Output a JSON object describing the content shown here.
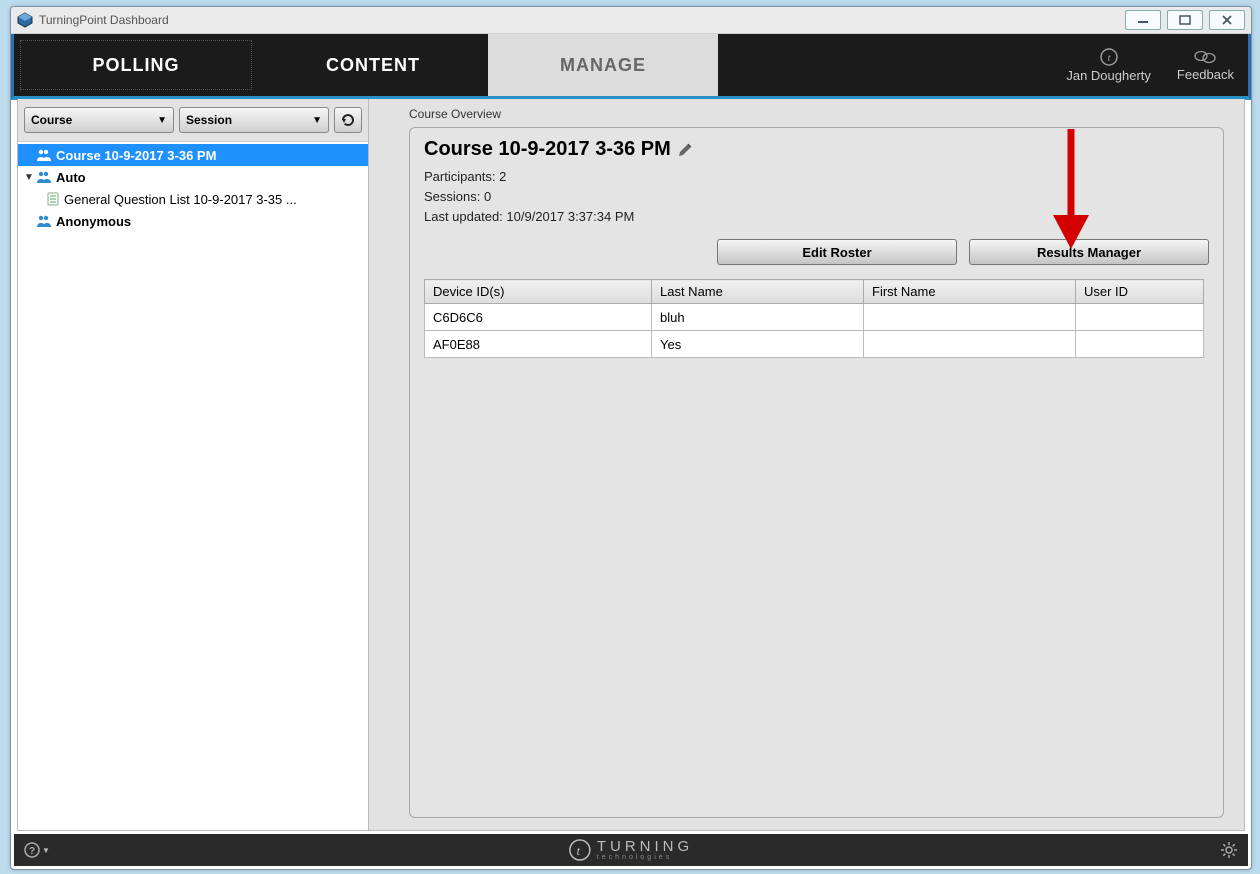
{
  "window": {
    "title": "TurningPoint Dashboard"
  },
  "tabs": {
    "polling": "POLLING",
    "content": "CONTENT",
    "manage": "MANAGE"
  },
  "user": {
    "name": "Jan Dougherty",
    "feedback": "Feedback"
  },
  "sidebar": {
    "dropdown_course": "Course",
    "dropdown_session": "Session",
    "items": [
      {
        "label": "Course 10-9-2017 3-36 PM"
      },
      {
        "label": "Auto"
      },
      {
        "label": "General Question List 10-9-2017 3-35 ..."
      },
      {
        "label": "Anonymous"
      }
    ]
  },
  "main": {
    "crumb": "Course Overview",
    "course_title": "Course 10-9-2017 3-36 PM",
    "participants_label": "Participants: 2",
    "sessions_label": "Sessions: 0",
    "updated_label": "Last updated: 10/9/2017 3:37:34 PM",
    "edit_roster": "Edit Roster",
    "results_manager": "Results Manager",
    "table": {
      "headers": {
        "device": "Device ID(s)",
        "last": "Last Name",
        "first": "First Name",
        "user": "User ID"
      },
      "rows": [
        {
          "device": "C6D6C6",
          "last": "bluh",
          "first": "",
          "user": ""
        },
        {
          "device": "AF0E88",
          "last": "Yes",
          "first": "",
          "user": ""
        }
      ]
    }
  },
  "footer": {
    "brand_main": "TURNING",
    "brand_sub": "technologies"
  }
}
